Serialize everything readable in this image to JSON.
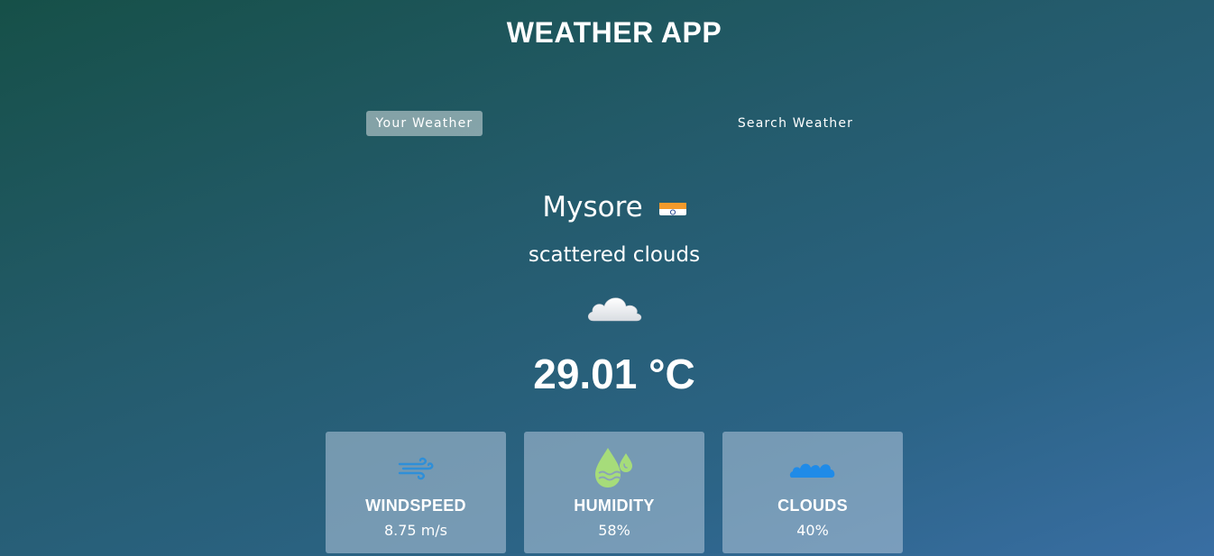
{
  "app": {
    "title": "WEATHER APP"
  },
  "tabs": [
    {
      "label": "Your Weather",
      "active": true
    },
    {
      "label": "Search Weather",
      "active": false
    }
  ],
  "weather": {
    "city": "Mysore",
    "country_flag": "India",
    "description": "scattered clouds",
    "icon": "scattered-clouds-icon",
    "temperature": "29.01 °C"
  },
  "stats": [
    {
      "label": "WINDSPEED",
      "value": "8.75 m/s",
      "icon": "wind-icon"
    },
    {
      "label": "HUMIDITY",
      "value": "58%",
      "icon": "humidity-icon"
    },
    {
      "label": "CLOUDS",
      "value": "40%",
      "icon": "clouds-icon"
    }
  ],
  "colors": {
    "wind_icon": "#2f8fd8",
    "humidity_icon": "#a6dc7a",
    "clouds_icon": "#1f8be8"
  }
}
